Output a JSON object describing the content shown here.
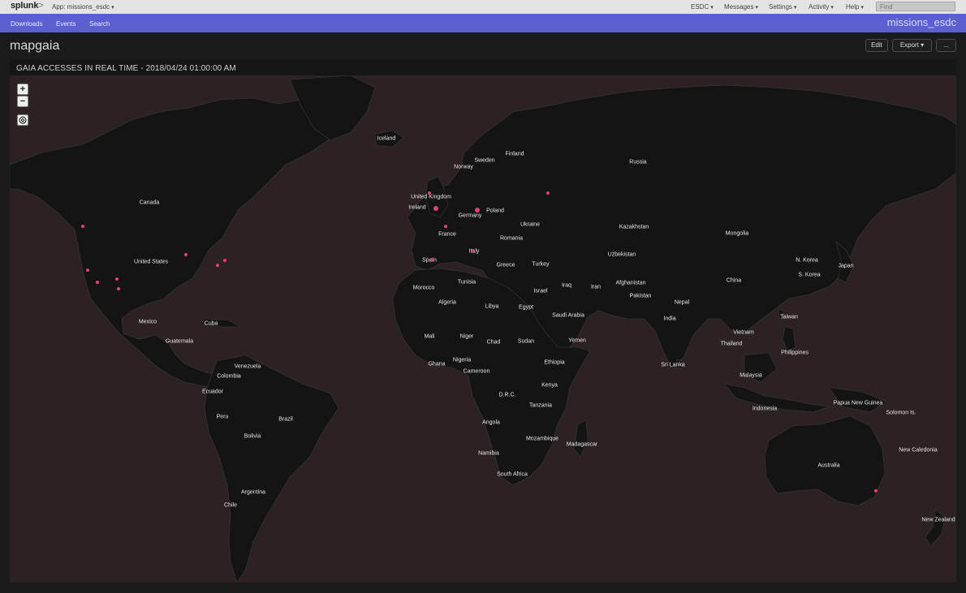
{
  "topbar": {
    "logo_main": "splunk",
    "logo_gt": ">",
    "app_menu": "App: missions_esdc",
    "menus": [
      {
        "label": "ESDC"
      },
      {
        "label": "Messages"
      },
      {
        "label": "Settings"
      },
      {
        "label": "Activity"
      },
      {
        "label": "Help"
      }
    ],
    "find_placeholder": "Find"
  },
  "appbar": {
    "nav": [
      {
        "label": "Downloads"
      },
      {
        "label": "Events"
      },
      {
        "label": "Search"
      }
    ],
    "app_name": "missions_esdc"
  },
  "dashboard": {
    "title": "mapgaia",
    "edit_label": "Edit",
    "export_label": "Export",
    "more_label": "..."
  },
  "panel": {
    "title": "GAIA ACCESSES IN REAL TIME - 2018/04/24 01:00:00 AM"
  },
  "map": {
    "land_color": "#141414",
    "ocean_color": "#2c2123",
    "marker_color": "#e0436f",
    "zoom_in": "+",
    "zoom_out": "−",
    "locate": "◎",
    "labels": [
      "Iceland",
      "Sweden",
      "Finland",
      "Norway",
      "Russia",
      "United Kingdom",
      "Ireland",
      "Poland",
      "Germany",
      "Ukraine",
      "France",
      "Romania",
      "Kazakhstan",
      "Mongolia",
      "Canada",
      "Spain",
      "Italy",
      "Greece",
      "Turkey",
      "Uzbekistan",
      "N. Korea",
      "Japan",
      "S. Korea",
      "United States",
      "Tunisia",
      "Morocco",
      "Iraq",
      "Iran",
      "Afghanistan",
      "Israel",
      "China",
      "Algeria",
      "Libya",
      "Egypt",
      "Pakistan",
      "Nepal",
      "Saudi Arabia",
      "India",
      "Mexico",
      "Cuba",
      "Taiwan",
      "Vietnam",
      "Mali",
      "Niger",
      "Chad",
      "Sudan",
      "Yemen",
      "Guatemala",
      "Thailand",
      "Philippines",
      "Nigeria",
      "Ghana",
      "Ethiopia",
      "Sri Lanka",
      "Venezuela",
      "Cameroon",
      "Colombia",
      "Malaysia",
      "Kenya",
      "Ecuador",
      "D.R.C.",
      "Tanzania",
      "Papua New Guinea",
      "Peru",
      "Brazil",
      "Indonesia",
      "Solomon Is.",
      "Angola",
      "Bolivia",
      "Mozambique",
      "Madagascar",
      "Namibia",
      "New Caledonia",
      "Australia",
      "South Africa",
      "Argentina",
      "Chile",
      "New Zealand"
    ]
  }
}
